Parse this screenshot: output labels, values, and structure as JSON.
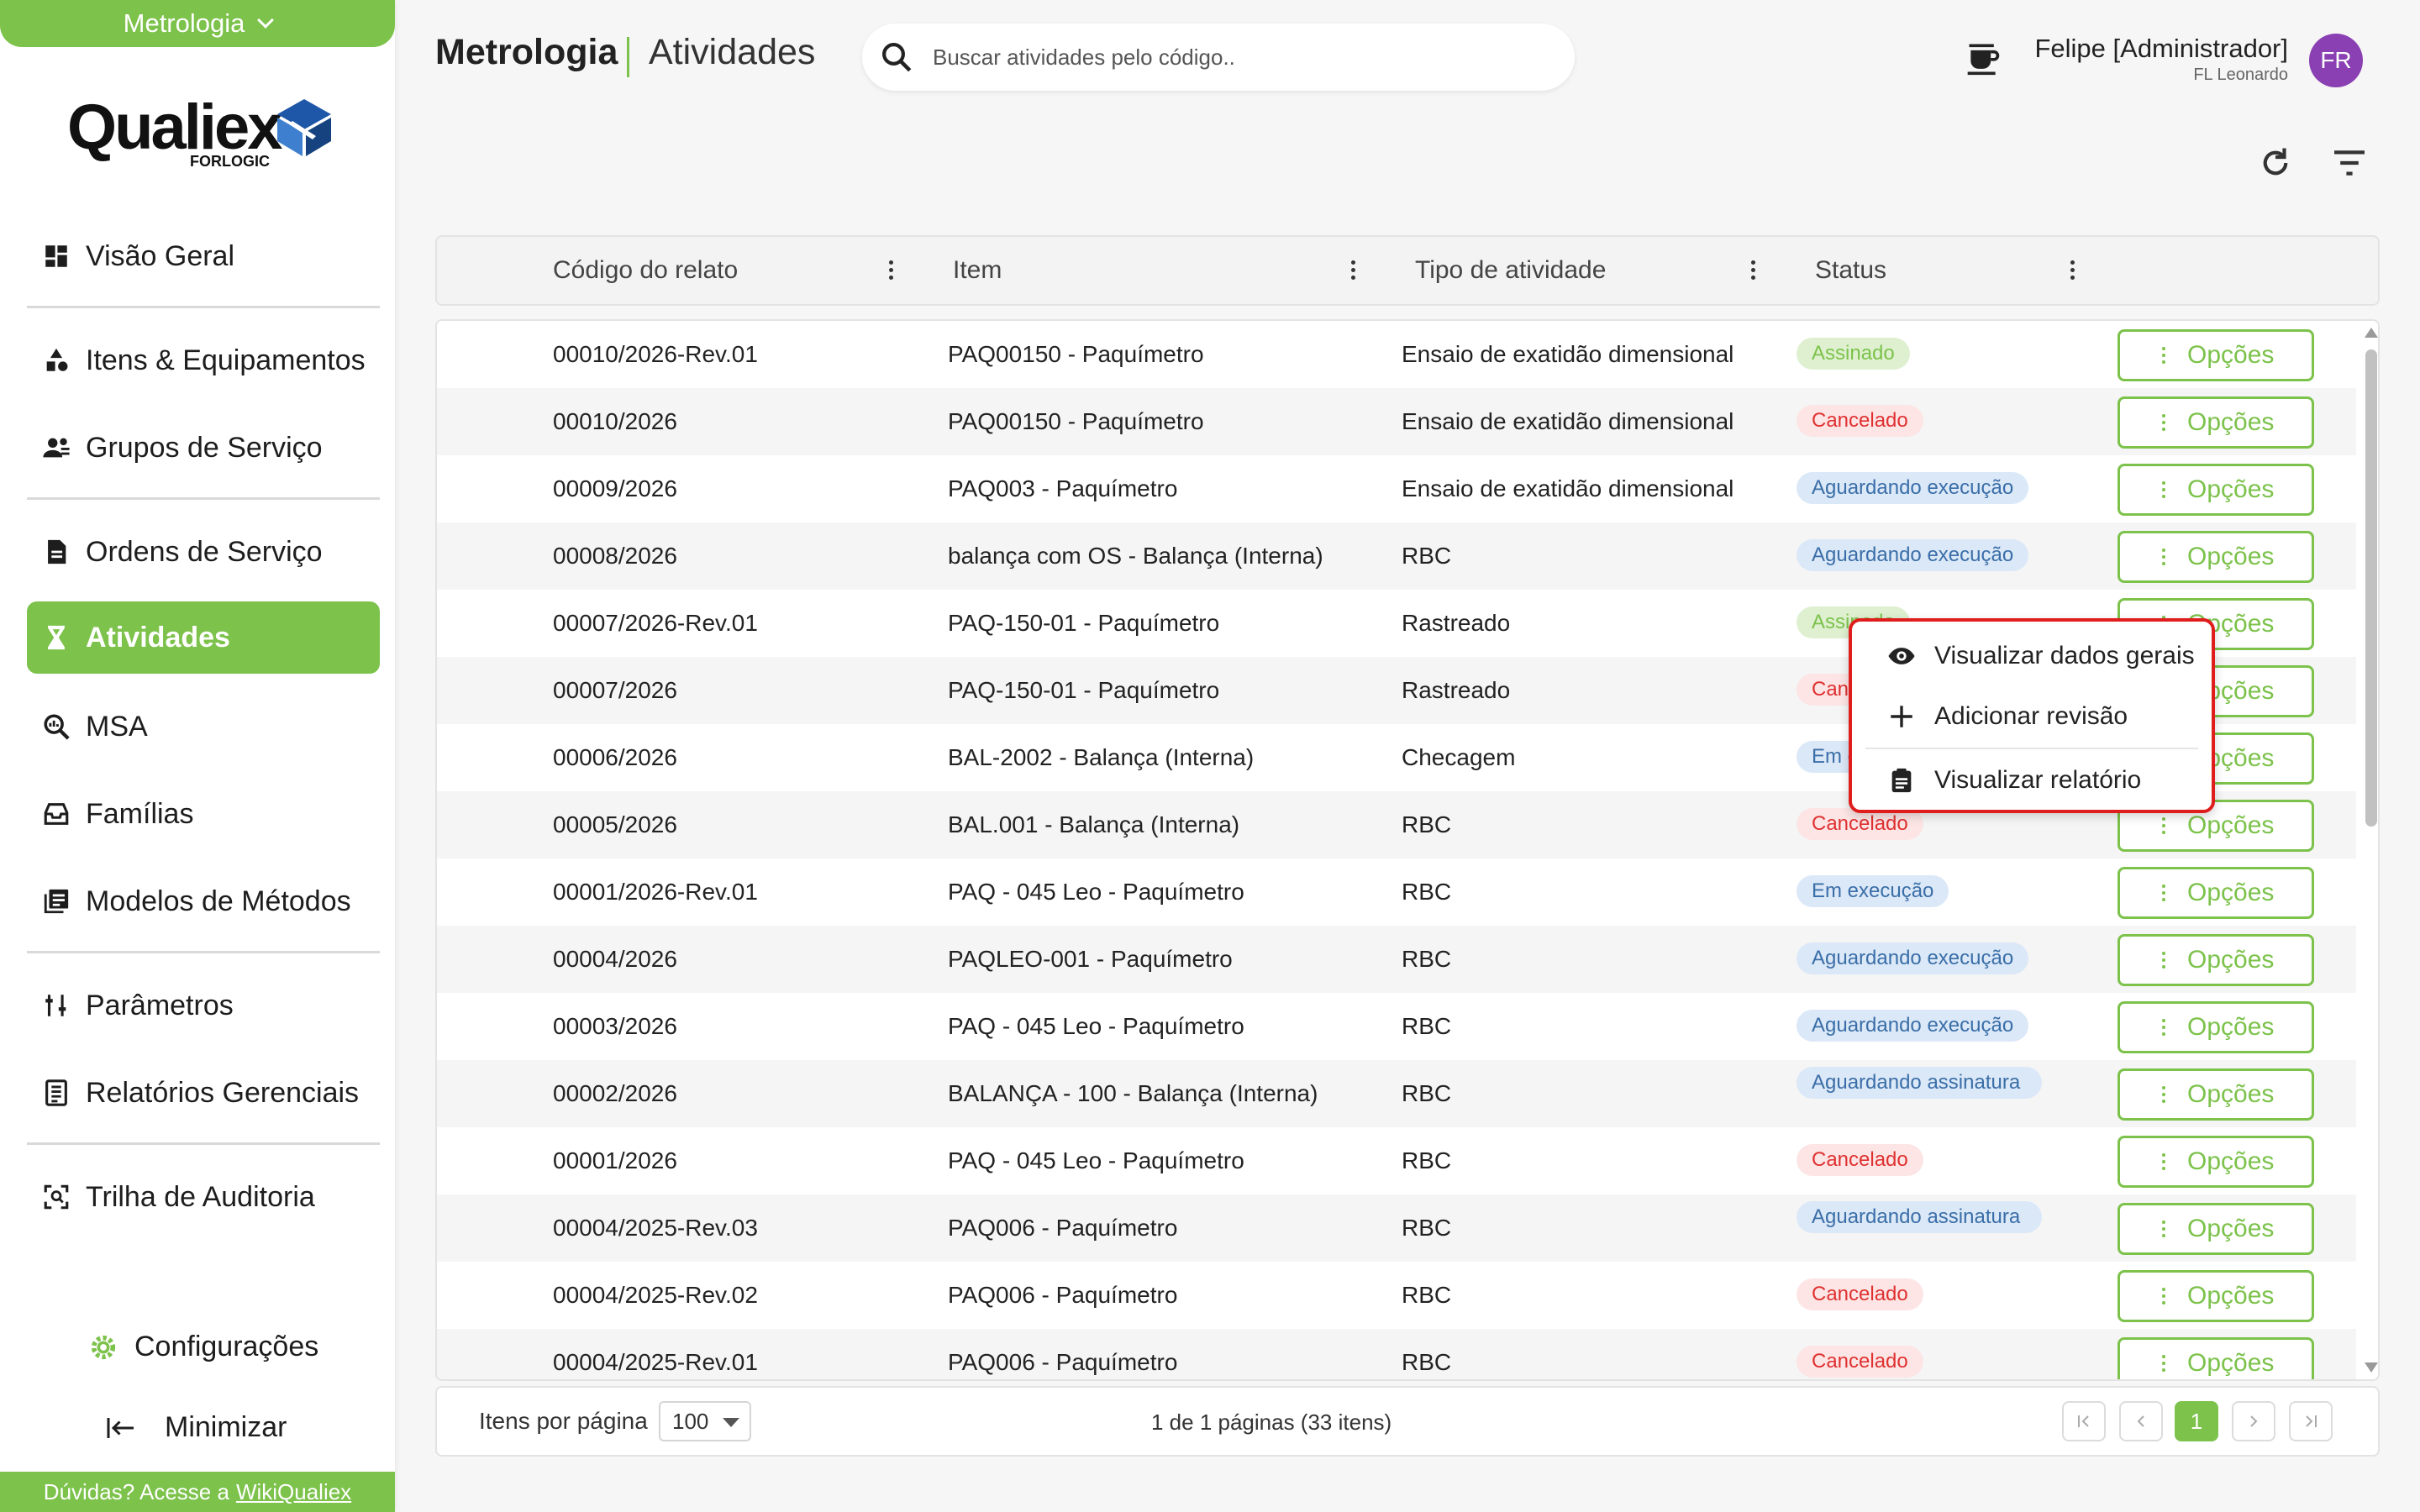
{
  "sidebar": {
    "module": "Metrologia",
    "logo_text": "Qualiex",
    "logo_sub": "FORLOGIC",
    "items": [
      {
        "label": "Visão Geral",
        "icon": "dashboard-icon"
      },
      {
        "label": "Itens & Equipamentos",
        "icon": "shapes-icon"
      },
      {
        "label": "Grupos de Serviço",
        "icon": "people-icon"
      },
      {
        "label": "Ordens de Serviço",
        "icon": "document-icon"
      },
      {
        "label": "Atividades",
        "icon": "hourglass-icon"
      },
      {
        "label": "MSA",
        "icon": "zoom-icon"
      },
      {
        "label": "Famílias",
        "icon": "inbox-icon"
      },
      {
        "label": "Modelos de Métodos",
        "icon": "library-icon"
      },
      {
        "label": "Parâmetros",
        "icon": "sliders-icon"
      },
      {
        "label": "Relatórios Gerenciais",
        "icon": "report-icon"
      },
      {
        "label": "Trilha de Auditoria",
        "icon": "audit-icon"
      }
    ],
    "settings_label": "Configurações",
    "minimize_label": "Minimizar",
    "help_text": "Dúvidas? Acesse a",
    "help_link": "WikiQualiex"
  },
  "header": {
    "app_title": "Metrologia",
    "page_title": "Atividades",
    "search_placeholder": "Buscar atividades pelo código..",
    "user_name": "Felipe [Administrador]",
    "user_org": "FL Leonardo",
    "avatar_initials": "FR"
  },
  "table": {
    "columns": [
      "Código do relato",
      "Item",
      "Tipo de atividade",
      "Status"
    ],
    "options_label": "Opções",
    "rows": [
      {
        "code": "00010/2026-Rev.01",
        "item": "PAQ00150 - Paquímetro",
        "type": "Ensaio de exatidão dimensional",
        "status": "Assinado",
        "status_kind": "green"
      },
      {
        "code": "00010/2026",
        "item": "PAQ00150 - Paquímetro",
        "type": "Ensaio de exatidão dimensional",
        "status": "Cancelado",
        "status_kind": "red"
      },
      {
        "code": "00009/2026",
        "item": "PAQ003 - Paquímetro",
        "type": "Ensaio de exatidão dimensional",
        "status": "Aguardando execução",
        "status_kind": "blue"
      },
      {
        "code": "00008/2026",
        "item": "balança com OS - Balança (Interna)",
        "type": "RBC",
        "status": "Aguardando execução",
        "status_kind": "blue"
      },
      {
        "code": "00007/2026-Rev.01",
        "item": "PAQ-150-01 - Paquímetro",
        "type": "Rastreado",
        "status": "Assinado",
        "status_kind": "green"
      },
      {
        "code": "00007/2026",
        "item": "PAQ-150-01 - Paquímetro",
        "type": "Rastreado",
        "status": "Cancelado",
        "status_kind": "red"
      },
      {
        "code": "00006/2026",
        "item": "BAL-2002 - Balança (Interna)",
        "type": "Checagem",
        "status": "Em execução",
        "status_kind": "blue"
      },
      {
        "code": "00005/2026",
        "item": "BAL.001 - Balança (Interna)",
        "type": "RBC",
        "status": "Cancelado",
        "status_kind": "red"
      },
      {
        "code": "00001/2026-Rev.01",
        "item": "PAQ - 045 Leo - Paquímetro",
        "type": "RBC",
        "status": "Em execução",
        "status_kind": "blue"
      },
      {
        "code": "00004/2026",
        "item": "PAQLEO-001 - Paquímetro",
        "type": "RBC",
        "status": "Aguardando execução",
        "status_kind": "blue"
      },
      {
        "code": "00003/2026",
        "item": "PAQ - 045 Leo - Paquímetro",
        "type": "RBC",
        "status": "Aguardando execução",
        "status_kind": "blue"
      },
      {
        "code": "00002/2026",
        "item": "BALANÇA - 100 - Balança (Interna)",
        "type": "RBC",
        "status": "Aguardando assinatura",
        "status_kind": "blue2"
      },
      {
        "code": "00001/2026",
        "item": "PAQ - 045 Leo - Paquímetro",
        "type": "RBC",
        "status": "Cancelado",
        "status_kind": "red"
      },
      {
        "code": "00004/2025-Rev.03",
        "item": "PAQ006 - Paquímetro",
        "type": "RBC",
        "status": "Aguardando assinatura",
        "status_kind": "blue2"
      },
      {
        "code": "00004/2025-Rev.02",
        "item": "PAQ006 - Paquímetro",
        "type": "RBC",
        "status": "Cancelado",
        "status_kind": "red"
      },
      {
        "code": "00004/2025-Rev.01",
        "item": "PAQ006 - Paquímetro",
        "type": "RBC",
        "status": "Cancelado",
        "status_kind": "red"
      }
    ]
  },
  "context_menu": {
    "items": [
      {
        "label": "Visualizar dados gerais",
        "icon": "eye-icon"
      },
      {
        "label": "Adicionar revisão",
        "icon": "plus-icon"
      },
      {
        "label": "Visualizar relatório",
        "icon": "clipboard-icon"
      }
    ]
  },
  "footer": {
    "items_per_page_label": "Itens por página",
    "items_per_page": "100",
    "page_info": "1 de 1 páginas (33 itens)",
    "current_page": "1"
  },
  "colors": {
    "accent": "#7cc24b",
    "danger": "#e03131",
    "info": "#3a6ea8",
    "highlight": "#e01d1d"
  }
}
